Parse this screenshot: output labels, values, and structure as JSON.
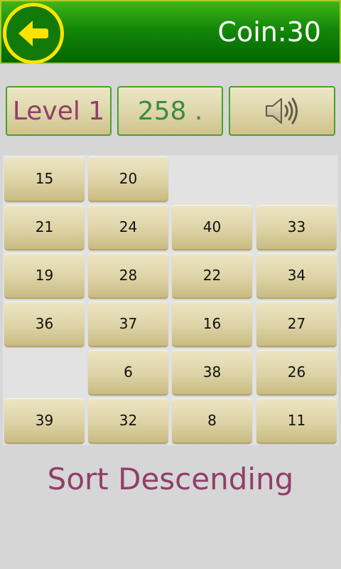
{
  "header": {
    "back_icon": "arrow-left-icon",
    "coin_text": "Coin:30",
    "colors": {
      "bar": "#14870a",
      "back_ring": "#ffe400"
    }
  },
  "stats": {
    "level": "Level 1",
    "score": "258 .",
    "sound_icon": "speaker-icon"
  },
  "grid": {
    "rows": [
      [
        "15",
        "20",
        "",
        ""
      ],
      [
        "21",
        "24",
        "40",
        "33"
      ],
      [
        "19",
        "28",
        "22",
        "34"
      ],
      [
        "36",
        "37",
        "16",
        "27"
      ],
      [
        "",
        "6",
        "38",
        "26"
      ],
      [
        "39",
        "32",
        "8",
        "11"
      ]
    ]
  },
  "instruction": "Sort Descending",
  "colors": {
    "instruction": "#913e68",
    "score": "#3c8a44",
    "button_border": "#48a22a"
  }
}
